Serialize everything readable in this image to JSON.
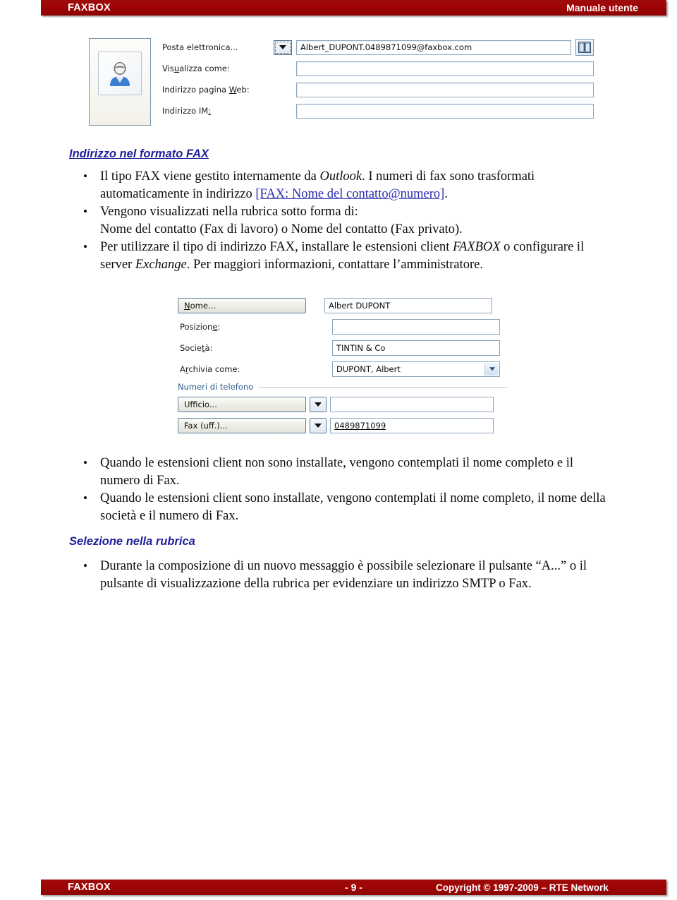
{
  "header": {
    "left_title": "FAXBOX",
    "right_title": "Manuale utente"
  },
  "footer": {
    "left_title": "FAXBOX",
    "page_number": "- 9 -",
    "copyright": "Copyright © 1997-2009 – RTE Network"
  },
  "screenshot_email": {
    "avatar_icon": "contact-person-icon",
    "rows": [
      {
        "label": "Posta elettronica...",
        "has_dropdown": true,
        "value": "Albert_DUPONT.0489871099@faxbox.com",
        "has_book_button": true
      },
      {
        "label_pre": "Vis",
        "label_underline": "u",
        "label_post": "alizza come:",
        "has_dropdown": false,
        "value": ""
      },
      {
        "label_pre": "Indirizzo pagina ",
        "label_underline": "W",
        "label_post": "eb:",
        "has_dropdown": false,
        "value": ""
      },
      {
        "label_pre": "Indirizzo IM",
        "label_underline": ":",
        "label_post": "",
        "has_dropdown": false,
        "value": ""
      }
    ],
    "book_icon": "address-book-icon"
  },
  "section_fax_format": {
    "heading": "Indirizzo nel formato FAX",
    "bullets": [
      {
        "id": "bullet-fax-type",
        "parts": [
          {
            "text": "Il tipo FAX viene gestito internamente da ",
            "style": "normal"
          },
          {
            "text": "Outlook",
            "style": "italic"
          },
          {
            "text": ". I numeri di fax sono trasformati automaticamente in indirizzo ",
            "style": "normal"
          },
          {
            "text": "[FAX: Nome del contatto@numero]",
            "style": "link"
          },
          {
            "text": ".",
            "style": "normal"
          }
        ]
      },
      {
        "id": "bullet-rubrica-display",
        "parts": [
          {
            "text": "Vengono visualizzati nella rubrica sotto forma di:",
            "style": "normal"
          },
          {
            "text": "__BR__",
            "style": "break"
          },
          {
            "text": "Nome del contatto (Fax di lavoro) o Nome del contatto (Fax privato).",
            "style": "normal"
          }
        ]
      },
      {
        "id": "bullet-client-extensions",
        "parts": [
          {
            "text": "Per utilizzare il tipo di indirizzo FAX, installare le estensioni client ",
            "style": "normal"
          },
          {
            "text": "FAXBOX",
            "style": "italic"
          },
          {
            "text": " o configurare il server ",
            "style": "normal"
          },
          {
            "text": "Exchange",
            "style": "italic"
          },
          {
            "text": ". Per maggiori informazioni, contattare l’amministratore.",
            "style": "normal"
          }
        ]
      }
    ]
  },
  "screenshot_contact": {
    "rows": [
      {
        "type": "button",
        "button_label": "Nome...",
        "button_accel": "N",
        "value": "Albert DUPONT",
        "combo": false
      },
      {
        "type": "label",
        "label": "Posizione:",
        "accel": "e",
        "value": "",
        "combo": false
      },
      {
        "type": "label",
        "label": "Società:",
        "accel": "t",
        "value": "TINTIN & Co",
        "combo": false
      },
      {
        "type": "label",
        "label": "Archivia come:",
        "accel": "r",
        "value": "DUPONT, Albert",
        "combo": true
      }
    ],
    "group_legend": "Numeri di telefono",
    "phone_rows": [
      {
        "button_label": "Ufficio...",
        "value": "",
        "underlined": false
      },
      {
        "button_label": "Fax (uff.)...",
        "value": "0489871099",
        "underlined": true
      }
    ]
  },
  "section_extensions_notes": {
    "bullets": [
      {
        "id": "bullet-no-extensions",
        "parts": [
          {
            "text": "Quando le estensioni client non sono installate, vengono contemplati il nome completo e il numero di Fax.",
            "style": "normal"
          }
        ]
      },
      {
        "id": "bullet-with-extensions",
        "parts": [
          {
            "text": "Quando le estensioni client sono installate, vengono contemplati il nome completo, il nome della società e il numero di Fax.",
            "style": "normal"
          }
        ]
      }
    ]
  },
  "section_rubrica_selection": {
    "heading": "Selezione nella rubrica",
    "bullets": [
      {
        "id": "bullet-rubrica-select",
        "parts": [
          {
            "text": "Durante la composizione di un nuovo messaggio è possibile selezionare il pulsante “A...” o il pulsante di visualizzazione della rubrica per evidenziare un indirizzo SMTP o Fax.",
            "style": "normal"
          }
        ]
      }
    ]
  },
  "colors": {
    "bar_red": "#9e0b0b",
    "heading_blue": "#1f1f9b",
    "link_blue": "#2a2ab0"
  }
}
